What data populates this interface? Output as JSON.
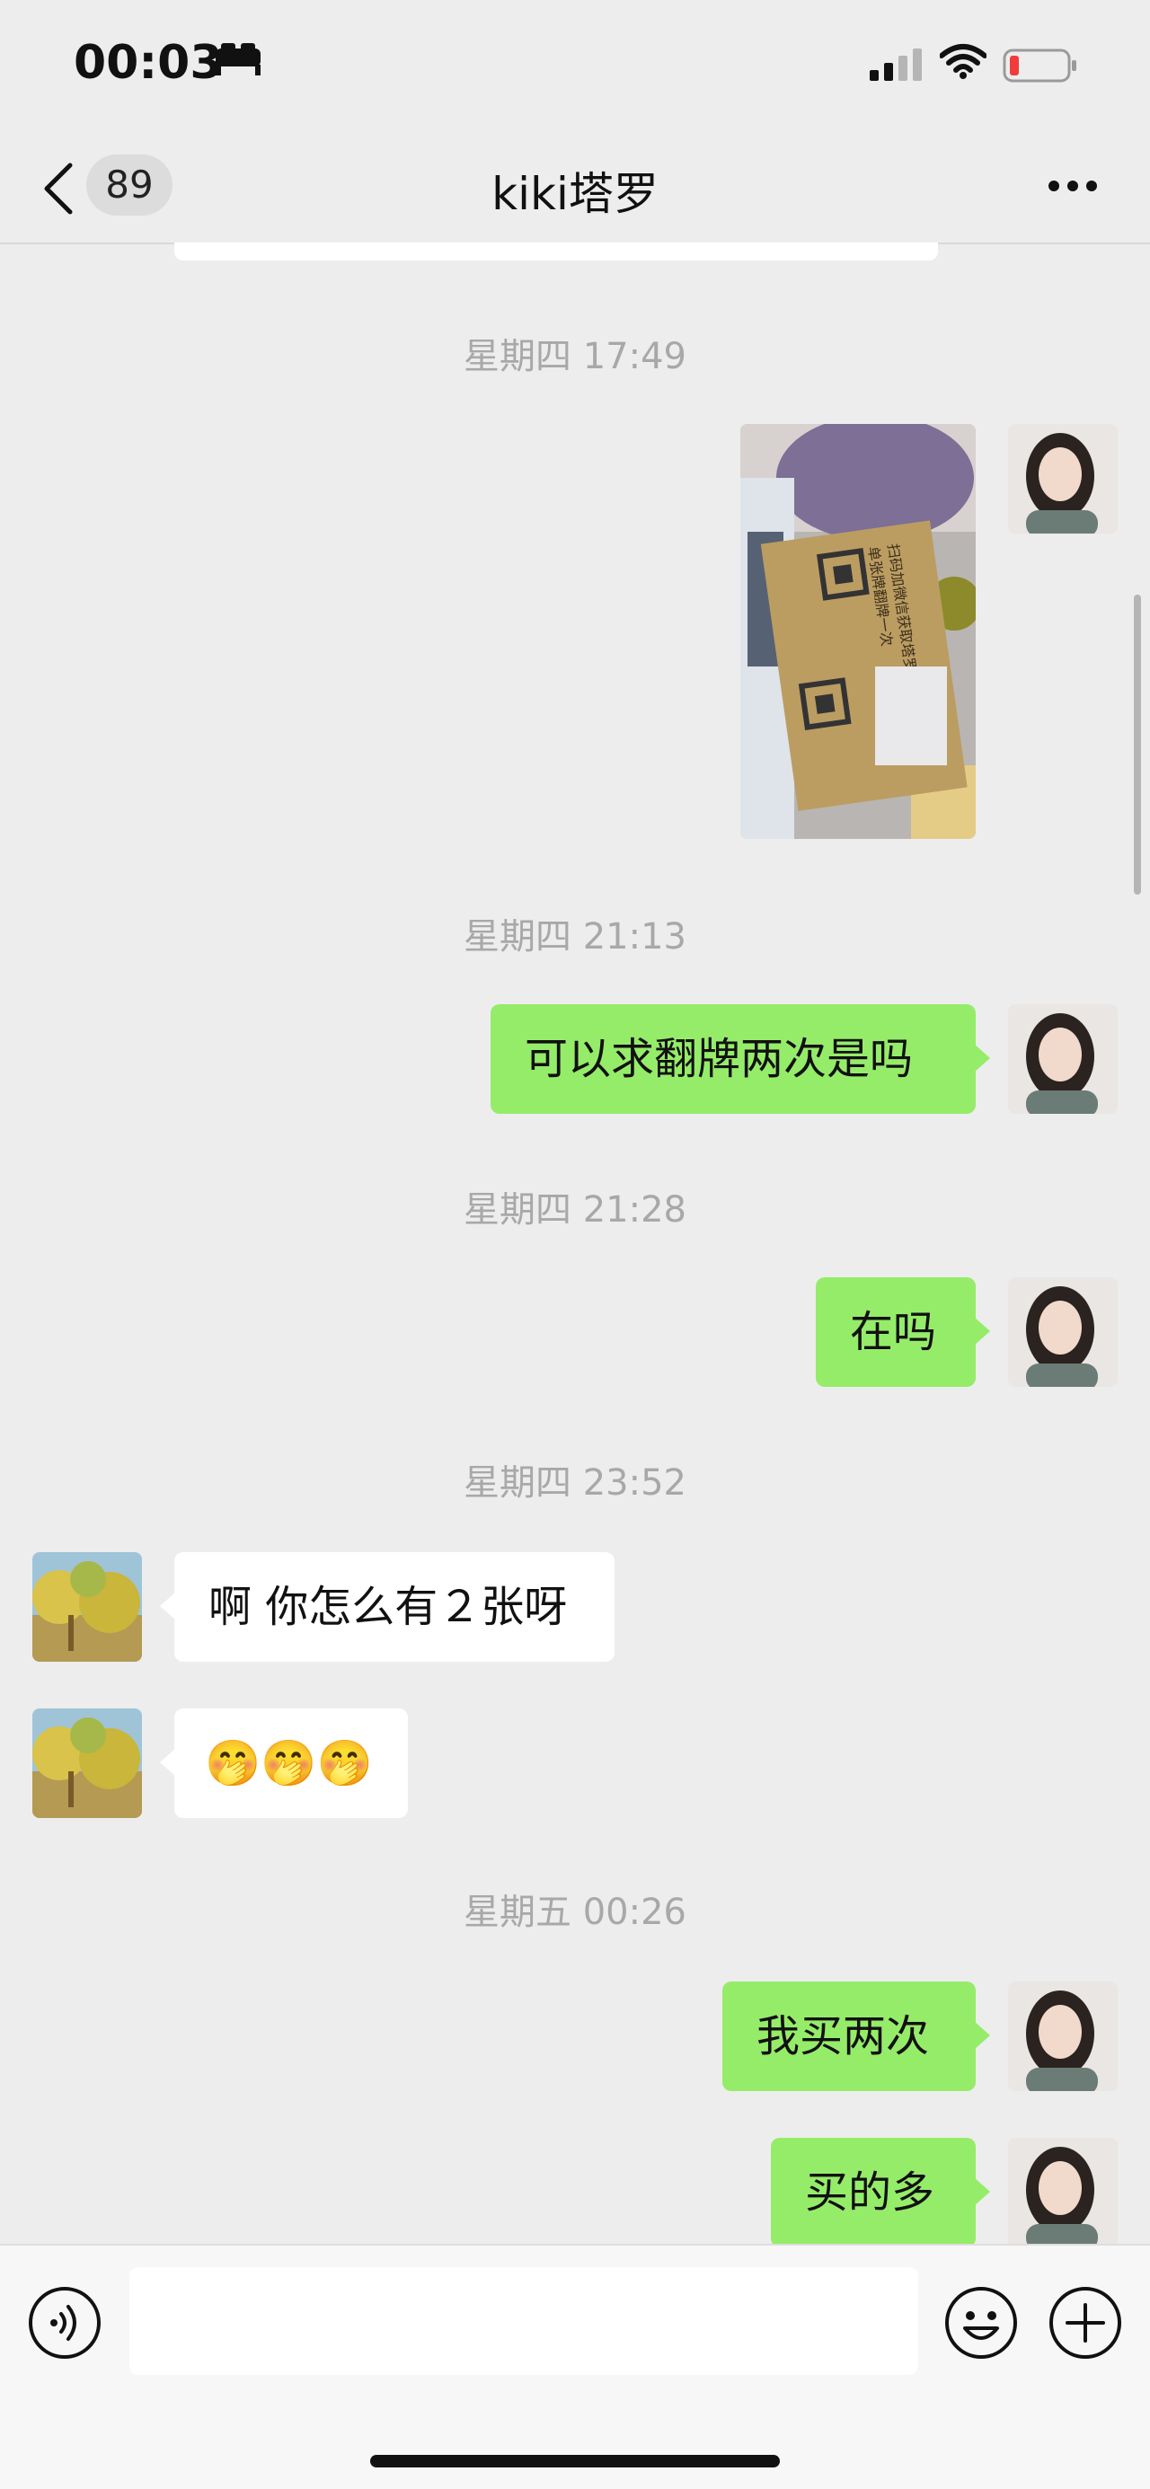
{
  "status_bar": {
    "time": "00:03",
    "sleep_icon": "bed-icon",
    "signal_icon": "cellular-signal-icon",
    "wifi_icon": "wifi-icon",
    "battery_icon": "battery-low-icon"
  },
  "header": {
    "back_icon": "chevron-left-icon",
    "unread_count": "89",
    "title": "kiki塔罗",
    "more_icon": "more-dots-icon"
  },
  "messages": {
    "t1": "星期四 17:49",
    "t2": "星期四 21:13",
    "m1": "可以求翻牌两次是吗",
    "t3": "星期四 21:28",
    "m2": "在吗",
    "t4": "星期四 23:52",
    "m3": "啊 你怎么有２张呀",
    "m4_emoji": "🤭🤭🤭",
    "t5": "星期五 00:26",
    "m5": "我买两次",
    "m6": "买的多"
  },
  "photo": {
    "card_text_1": "扫码加微信获取塔罗牌",
    "card_text_2": "单张牌翻牌一次"
  },
  "input_bar": {
    "placeholder": "",
    "voice_icon": "voice-icon",
    "emoji_icon": "emoji-icon",
    "plus_icon": "plus-circle-icon"
  },
  "colors": {
    "background": "#ededed",
    "sent_bubble": "#95ec69",
    "received_bubble": "#ffffff",
    "timestamp": "#a8a8a8"
  }
}
